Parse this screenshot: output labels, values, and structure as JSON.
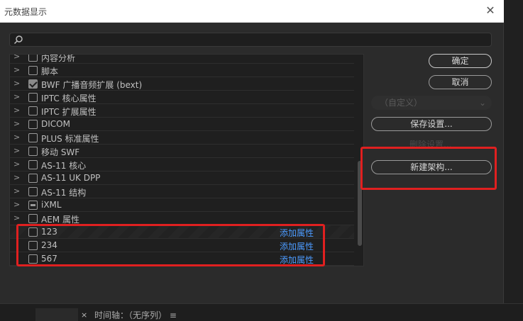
{
  "window": {
    "title": "元数据显示",
    "close_glyph": "✕"
  },
  "search": {
    "placeholder": "",
    "value": ""
  },
  "tree": {
    "rows": [
      {
        "label": "内容分析",
        "checked": "none"
      },
      {
        "label": "脚本",
        "checked": "none"
      },
      {
        "label": "BWF 广播音频扩展 (bext)",
        "checked": "full"
      },
      {
        "label": "IPTC 核心属性",
        "checked": "none"
      },
      {
        "label": "IPTC 扩展属性",
        "checked": "none"
      },
      {
        "label": "DICOM",
        "checked": "none"
      },
      {
        "label": "PLUS 标准属性",
        "checked": "none"
      },
      {
        "label": "移动 SWF",
        "checked": "none"
      },
      {
        "label": "AS-11 核心",
        "checked": "none"
      },
      {
        "label": "AS-11 UK DPP",
        "checked": "none"
      },
      {
        "label": "AS-11 结构",
        "checked": "none"
      },
      {
        "label": "iXML",
        "checked": "partial"
      },
      {
        "label": "AEM 属性",
        "checked": "none"
      }
    ],
    "custom_rows": [
      {
        "label": "123",
        "action": "添加属性"
      },
      {
        "label": "234",
        "action": "添加属性"
      },
      {
        "label": "567",
        "action": "添加属性"
      }
    ]
  },
  "buttons": {
    "ok": "确定",
    "cancel": "取消",
    "preset_select": "（自定义）",
    "save_settings": "保存设置...",
    "delete_settings": "删除设置...",
    "new_schema": "新建架构..."
  },
  "bottom_bar": {
    "close_glyph": "×",
    "timeline_label": "时间轴：（无序列）",
    "menu_glyph": "≡"
  },
  "colors": {
    "highlight": "#e02020",
    "link": "#4c9bff"
  }
}
